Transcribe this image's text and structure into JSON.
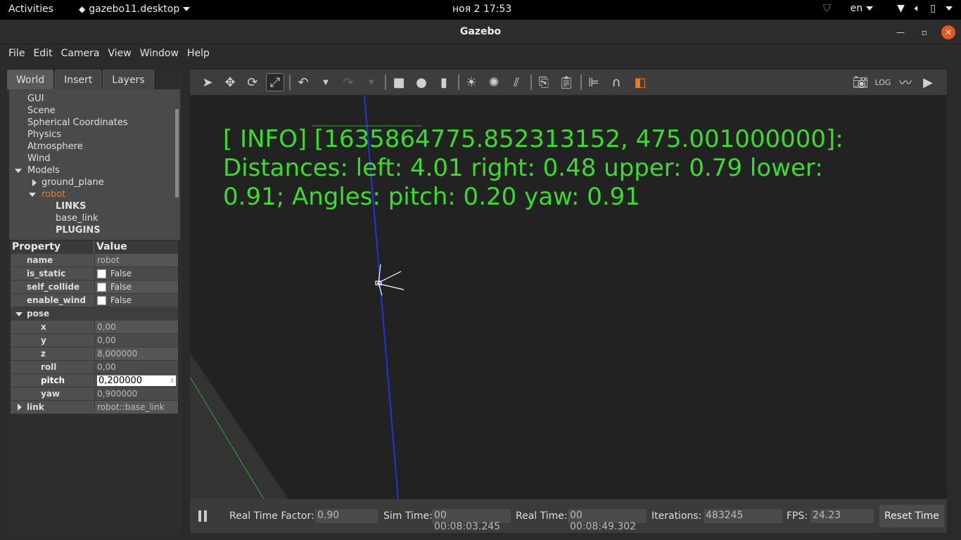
{
  "topbar": {
    "activities": "Activities",
    "app_menu": "gazebo11.desktop",
    "clock": "ноя 2  17:53",
    "lang": "en"
  },
  "window": {
    "title": "Gazebo"
  },
  "menu": {
    "file": "File",
    "edit": "Edit",
    "camera": "Camera",
    "view": "View",
    "window": "Window",
    "help": "Help"
  },
  "tabs": {
    "world": "World",
    "insert": "Insert",
    "layers": "Layers"
  },
  "tree": {
    "gui": "GUI",
    "scene": "Scene",
    "spherical": "Spherical Coordinates",
    "physics": "Physics",
    "atmosphere": "Atmosphere",
    "wind": "Wind",
    "models": "Models",
    "ground_plane": "ground_plane",
    "robot": "robot",
    "links": "LINKS",
    "base_link": "base_link",
    "plugins": "PLUGINS"
  },
  "props": {
    "header_property": "Property",
    "header_value": "Value",
    "name_k": "name",
    "name_v": "robot",
    "is_static_k": "is_static",
    "is_static_v": "False",
    "self_collide_k": "self_collide",
    "self_collide_v": "False",
    "enable_wind_k": "enable_wind",
    "enable_wind_v": "False",
    "pose_k": "pose",
    "x_k": "x",
    "x_v": "0,00",
    "y_k": "y",
    "y_v": "0,00",
    "z_k": "z",
    "z_v": "8,000000",
    "roll_k": "roll",
    "roll_v": "0,00",
    "pitch_k": "pitch",
    "pitch_v": "0,200000",
    "yaw_k": "yaw",
    "yaw_v": "0,900000",
    "link_k": "link",
    "link_v": "robot::base_link"
  },
  "viewport": {
    "info_line1": "[ INFO] [1635864775.852313152, 475.001000000]:",
    "info_line2": "Distances: left: 4.01 right: 0.48 upper: 0.79 lower:",
    "info_line3": "0.91; Angles: pitch: 0.20 yaw: 0.91"
  },
  "status": {
    "rtf_label": "Real Time Factor:",
    "rtf_value": "0.90",
    "sim_label": "Sim Time:",
    "sim_value": "00 00:08:03.245",
    "real_label": "Real Time:",
    "real_value": "00 00:08:49.302",
    "iter_label": "Iterations:",
    "iter_value": "483245",
    "fps_label": "FPS:",
    "fps_value": "24.23",
    "reset": "Reset Time"
  },
  "colors": {
    "info_text": "#3cdc2a",
    "close_button": "#e95420",
    "robot_selected": "#f07a1a"
  }
}
